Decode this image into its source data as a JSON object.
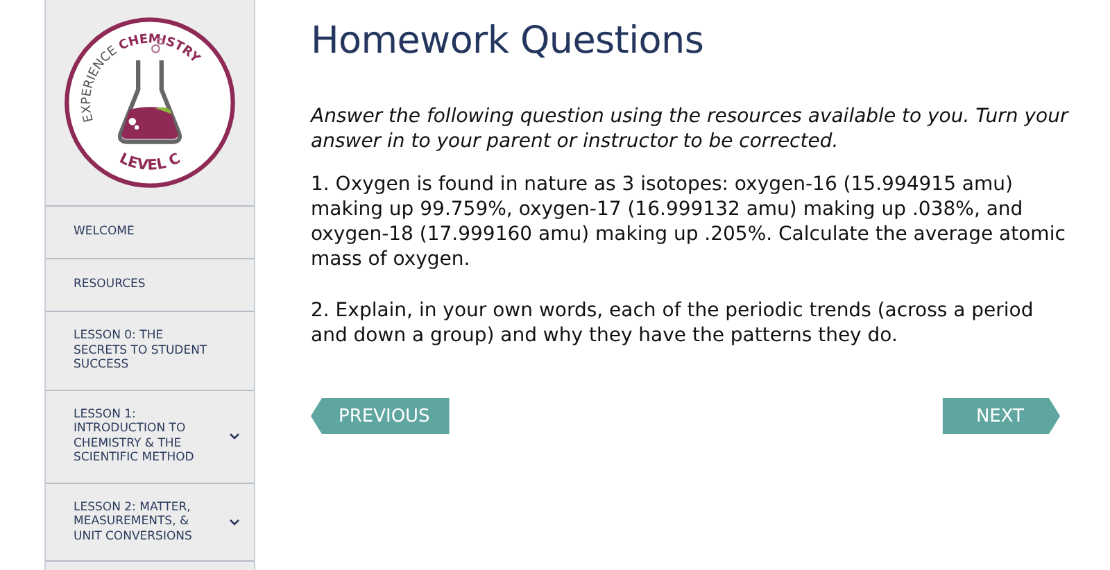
{
  "logo": {
    "top_left": "EXPERIENCE",
    "top_right": "CHEMISTRY",
    "bottom": "LEVEL C"
  },
  "sidebar": {
    "items": [
      {
        "label": "WELCOME",
        "expandable": false
      },
      {
        "label": "RESOURCES",
        "expandable": false
      },
      {
        "label": "LESSON 0: THE SECRETS TO STUDENT SUCCESS",
        "expandable": false
      },
      {
        "label": "LESSON 1: INTRODUCTION TO CHEMISTRY & THE SCIENTIFIC METHOD",
        "expandable": true
      },
      {
        "label": "LESSON 2: MATTER, MEASUREMENTS, & UNIT CONVERSIONS",
        "expandable": true
      }
    ]
  },
  "title": "Homework Questions",
  "instructions": "Answer the following question using the resources available to you. Turn your answer in to your parent or instructor to be corrected.",
  "questions": [
    "1. Oxygen is found in nature as 3 isotopes: oxygen-16 (15.994915 amu) making up 99.759%, oxygen-17 (16.999132 amu) making up .038%, and oxygen-18 (17.999160 amu) making up .205%. Calculate the average atomic mass of oxygen.",
    "2. Explain, in your own words, each of the periodic trends (across a period and down a group) and why they have the patterns they do."
  ],
  "buttons": {
    "previous": "PREVIOUS",
    "next": "NEXT"
  }
}
